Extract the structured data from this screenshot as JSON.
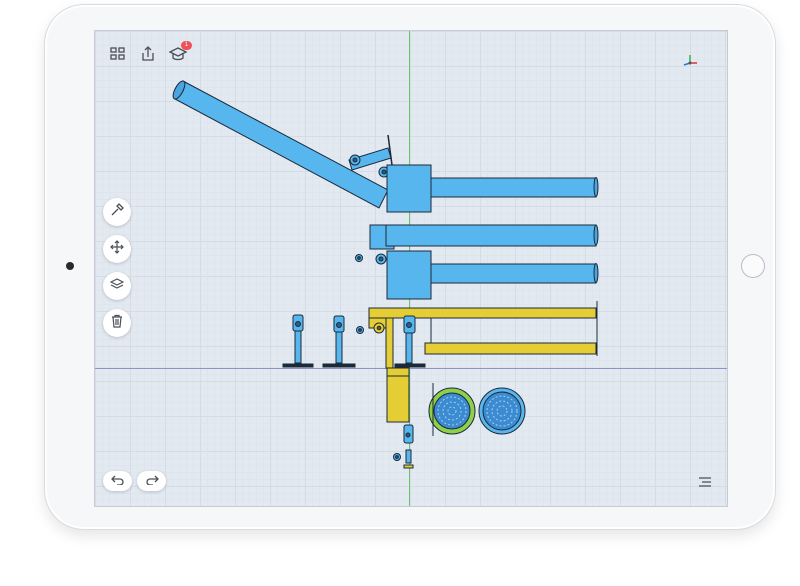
{
  "app": {
    "toolbar": {
      "apps_icon": "grid-icon",
      "share_icon": "share-icon",
      "learn_icon": "graduation-cap-icon",
      "learn_badge": "1"
    },
    "side_tools": [
      {
        "name": "build",
        "icon": "hammer-icon"
      },
      {
        "name": "transform",
        "icon": "move-arrows-icon"
      },
      {
        "name": "layers",
        "icon": "layers-icon"
      },
      {
        "name": "delete",
        "icon": "trash-icon"
      }
    ],
    "history": {
      "undo_icon": "undo-icon",
      "redo_icon": "redo-icon"
    },
    "menu_icon": "menu-lines-icon",
    "orientation_gizmo": "axis-gizmo-icon",
    "colors": {
      "background": "#e2e9f1",
      "part_blue": "#58b6ef",
      "part_yellow": "#e4cd35",
      "part_green": "#8fd04a",
      "outline": "#1b2a3a",
      "axis_green": "#6cc56c",
      "axis_blue": "#8d95c8"
    }
  }
}
